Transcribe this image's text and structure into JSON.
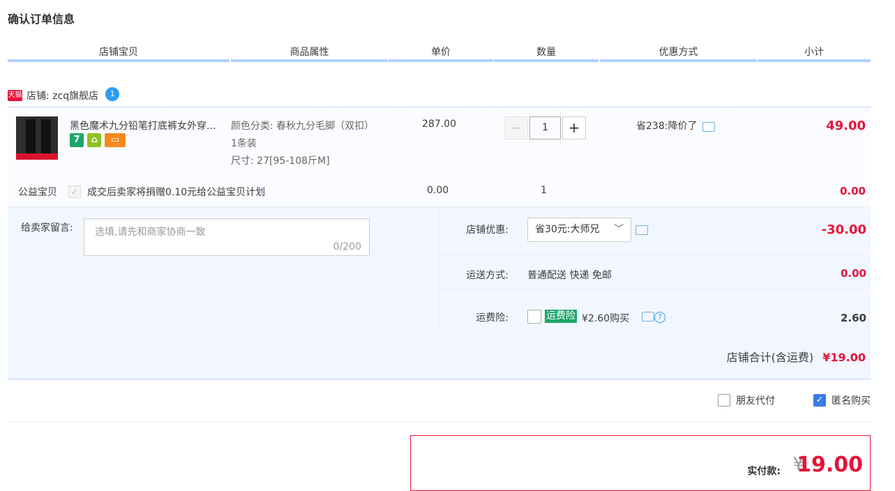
{
  "page": {
    "title": "确认订单信息"
  },
  "table_header": [
    "店铺宝贝",
    "商品属性",
    "单价",
    "数量",
    "优惠方式",
    "小计"
  ],
  "shop": {
    "badge": "天猫",
    "name": "店铺: zcq旗舰店",
    "ww_icon": "wangwang-icon"
  },
  "item": {
    "title": "黑色魔术九分铅笔打底裤女外穿...",
    "attrs": [
      "颜色分类:  春秋九分毛脚（双扣）",
      "1条装",
      "尺寸:  27[95-108斤M]"
    ],
    "unit_price": "287.00",
    "quantity": "1",
    "minus": "−",
    "plus": "+",
    "discount": "省238:降价了",
    "subtotal": "49.00",
    "service_icons": {
      "seven": "7",
      "cart": "⌂",
      "card": "▭"
    }
  },
  "charity": {
    "label": "公益宝贝",
    "check": "✓",
    "text": "成交后卖家将捐赠0.10元给公益宝贝计划",
    "price": "0.00",
    "qty": "1",
    "subtotal": "0.00"
  },
  "message": {
    "label": "给卖家留言:",
    "placeholder": "选填,请先和商家协商一致",
    "count": "0/200"
  },
  "store_discount": {
    "label": "店铺优惠:",
    "selected": "省30元:大师兄",
    "value": "-30.00"
  },
  "shipping": {
    "label": "运送方式:",
    "method": "普通配送 快递 免邮",
    "value": "0.00"
  },
  "insurance": {
    "label": "运费险:",
    "badge": "运费险",
    "text": "¥2.60购买",
    "help": "?",
    "value": "2.60"
  },
  "store_total": {
    "label": "店铺合计(含运费)",
    "amount": "¥19.00"
  },
  "options": {
    "friend_pay": "朋友代付",
    "anonymous": "匿名购买",
    "check": "✓"
  },
  "payment": {
    "label": "实付款:",
    "yen": "¥",
    "amount": "19.00"
  },
  "colors": {
    "accent_red": "#e5133a",
    "header_bar": "#b2d1ff",
    "panel_bg": "#f2f7ff",
    "checkbox_blue": "#3a7ce5"
  }
}
